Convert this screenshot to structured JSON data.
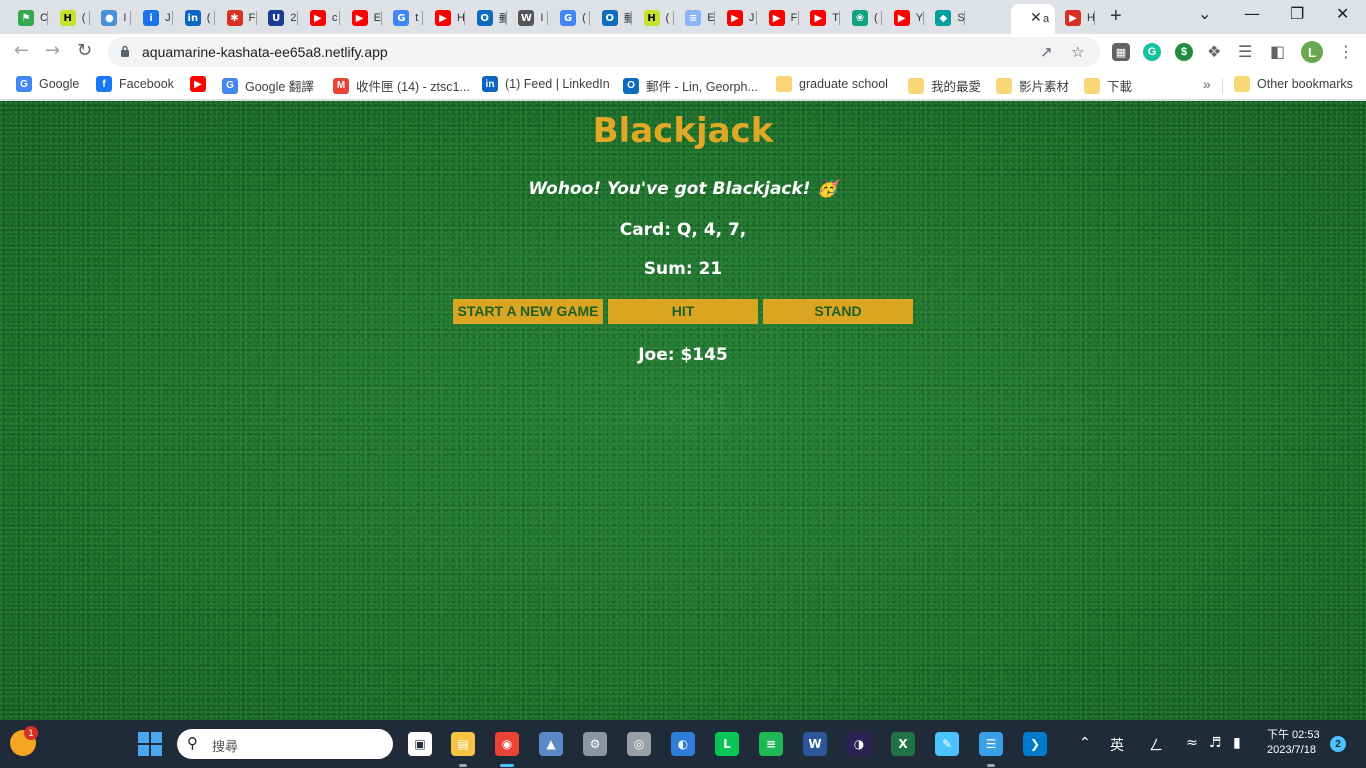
{
  "browser": {
    "tabs": [
      {
        "icon": "shield-icon",
        "color": "#34a853",
        "glyph": "⚑",
        "title": "C"
      },
      {
        "icon": "h-icon",
        "color": "#c6e12a",
        "glyph": "H",
        "title": "("
      },
      {
        "icon": "globe-icon",
        "color": "#4a90d9",
        "glyph": "●",
        "title": "I"
      },
      {
        "icon": "info-icon",
        "color": "#1a73e8",
        "glyph": "i",
        "title": "J"
      },
      {
        "icon": "linkedin-icon",
        "color": "#0a66c2",
        "glyph": "in",
        "title": "("
      },
      {
        "icon": "bug-icon",
        "color": "#d93025",
        "glyph": "✱",
        "title": "F"
      },
      {
        "icon": "usn-icon",
        "color": "#1a3d8f",
        "glyph": "U",
        "title": "2"
      },
      {
        "icon": "youtube-icon",
        "color": "#ff0000",
        "glyph": "▶",
        "title": "c"
      },
      {
        "icon": "youtube-icon",
        "color": "#ff0000",
        "glyph": "▶",
        "title": "E"
      },
      {
        "icon": "google-icon",
        "color": "#4285f4",
        "glyph": "G",
        "title": "t"
      },
      {
        "icon": "youtube-icon",
        "color": "#ff0000",
        "glyph": "▶",
        "title": "H"
      },
      {
        "icon": "outlook-icon",
        "color": "#0f6cbd",
        "glyph": "O",
        "title": "郵"
      },
      {
        "icon": "wikipedia-icon",
        "color": "#555555",
        "glyph": "W",
        "title": "I"
      },
      {
        "icon": "translate-icon",
        "color": "#4285f4",
        "glyph": "G",
        "title": "("
      },
      {
        "icon": "outlook-icon",
        "color": "#0f6cbd",
        "glyph": "O",
        "title": "郵"
      },
      {
        "icon": "h-icon",
        "color": "#c6e12a",
        "glyph": "H",
        "title": "("
      },
      {
        "icon": "doc-icon",
        "color": "#8ab4f8",
        "glyph": "≡",
        "title": "E"
      },
      {
        "icon": "youtube-icon",
        "color": "#ff0000",
        "glyph": "▶",
        "title": "J"
      },
      {
        "icon": "youtube-icon",
        "color": "#ff0000",
        "glyph": "▶",
        "title": "F"
      },
      {
        "icon": "youtube-icon",
        "color": "#ff0000",
        "glyph": "▶",
        "title": "T"
      },
      {
        "icon": "chatgpt-icon",
        "color": "#10a37f",
        "glyph": "❀",
        "title": "("
      },
      {
        "icon": "youtube-icon",
        "color": "#ff0000",
        "glyph": "▶",
        "title": "Y"
      },
      {
        "icon": "diamond-icon",
        "color": "#00a19c",
        "glyph": "◆",
        "title": "S"
      },
      {
        "icon": "none",
        "color": "#ffffff",
        "glyph": "",
        "title": "a",
        "active": true
      },
      {
        "icon": "hulu-icon",
        "color": "#d93025",
        "glyph": "▶",
        "title": "H"
      }
    ],
    "url": "aquamarine-kashata-ee65a8.netlify.app",
    "profile_initial": "L",
    "bookmarks": [
      {
        "label": "Google",
        "icon": "google-icon",
        "color": "#4285f4",
        "glyph": "G"
      },
      {
        "label": "Facebook",
        "icon": "facebook-icon",
        "color": "#1877f2",
        "glyph": "f"
      },
      {
        "label": "",
        "icon": "youtube-icon",
        "color": "#ff0000",
        "glyph": "▶"
      },
      {
        "label": "Google 翻譯",
        "icon": "translate-icon",
        "color": "#4285f4",
        "glyph": "G"
      },
      {
        "label": "收件匣 (14) - ztsc1...",
        "icon": "gmail-icon",
        "color": "#ea4335",
        "glyph": "M"
      },
      {
        "label": "(1) Feed | LinkedIn",
        "icon": "linkedin-icon",
        "color": "#0a66c2",
        "glyph": "in"
      },
      {
        "label": "郵件 - Lin, Georph...",
        "icon": "outlook-icon",
        "color": "#0f6cbd",
        "glyph": "O"
      },
      {
        "label": "graduate school",
        "icon": "folder-icon",
        "color": "#f7d774",
        "glyph": ""
      },
      {
        "label": "我的最愛",
        "icon": "folder-icon",
        "color": "#f7d774",
        "glyph": ""
      },
      {
        "label": "影片素材",
        "icon": "folder-icon",
        "color": "#f7d774",
        "glyph": ""
      },
      {
        "label": "下載",
        "icon": "folder-icon",
        "color": "#f7d774",
        "glyph": ""
      }
    ],
    "more_bookmarks": "»",
    "other_bookmarks": "Other bookmarks"
  },
  "game": {
    "title": "Blackjack",
    "message": "Wohoo! You've got Blackjack! 🥳",
    "cards": "Card: Q, 4, 7,",
    "sum": "Sum: 21",
    "buttons": {
      "new_game": "START A NEW GAME",
      "hit": "HIT",
      "stand": "STAND"
    },
    "player": "Joe: $145",
    "colors": {
      "title": "#e0a825",
      "button_bg": "#daa520",
      "button_text": "#1f5e25",
      "felt": "#1d6f2c"
    }
  },
  "taskbar": {
    "search_placeholder": "搜尋",
    "weather_badge": "1",
    "apps": [
      {
        "name": "task-view",
        "color": "#ffffff"
      },
      {
        "name": "file-explorer",
        "color": "#f6c443"
      },
      {
        "name": "chrome",
        "color": "#ea4335"
      },
      {
        "name": "photos",
        "color": "#5a89c6"
      },
      {
        "name": "settings",
        "color": "#8a96a3"
      },
      {
        "name": "media",
        "color": "#9aa0a6"
      },
      {
        "name": "edge",
        "color": "#2f7ed8"
      },
      {
        "name": "line",
        "color": "#06c755"
      },
      {
        "name": "spotify",
        "color": "#1db954"
      },
      {
        "name": "word",
        "color": "#2b579a"
      },
      {
        "name": "eclipse",
        "color": "#2c2255"
      },
      {
        "name": "excel",
        "color": "#217346"
      },
      {
        "name": "paint",
        "color": "#4cc2ff"
      },
      {
        "name": "notepad",
        "color": "#3aa0e6"
      },
      {
        "name": "vscode",
        "color": "#007acc"
      }
    ],
    "ime": "英",
    "ime2": "ㄥ",
    "time": "下午 02:53",
    "date": "2023/7/18",
    "notifications": "2"
  }
}
